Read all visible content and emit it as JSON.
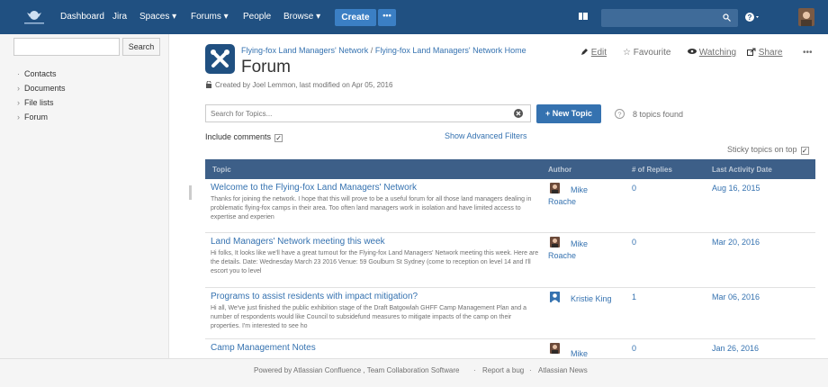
{
  "topnav": {
    "menu": [
      "Dashboard",
      "Jira",
      "Spaces ▾",
      "Forums ▾",
      "People",
      "Browse ▾"
    ],
    "create_label": "Create",
    "more_label": "•••"
  },
  "sidebar": {
    "search_button": "Search",
    "items": [
      {
        "label": "Contacts",
        "chevron": "·"
      },
      {
        "label": "Documents",
        "chevron": "›"
      },
      {
        "label": "File lists",
        "chevron": "›"
      },
      {
        "label": "Forum",
        "chevron": "›"
      }
    ]
  },
  "breadcrumb": {
    "parts": [
      "Flying-fox Land Managers' Network",
      "/",
      "Flying-fox Land Managers' Network Home"
    ]
  },
  "page": {
    "title": "Forum",
    "meta": "Created by Joel Lemmon, last modified on Apr 05, 2016"
  },
  "actions": {
    "edit": "Edit",
    "favourite": "Favourite",
    "watching": "Watching",
    "share": "Share",
    "more": "•••"
  },
  "search": {
    "placeholder": "Search for Topics...",
    "new_topic": "+ New Topic",
    "found": "8 topics found",
    "include_comments": "Include comments",
    "advanced": "Show Advanced Filters",
    "sticky": "Sticky topics on top",
    "checkmark": "✓"
  },
  "table": {
    "headers": [
      "Topic",
      "Author",
      "# of Replies",
      "Last Activity Date"
    ],
    "rows": [
      {
        "title": "Welcome to the Flying-fox Land Managers' Network",
        "excerpt": "Thanks for joining the network. I hope that this will prove to be a useful forum for all those land managers dealing in problematic flying-fox camps in their area. Too often land managers work in isolation and have limited access to expertise and experien",
        "author_first": "Mike",
        "author_last": "Roache",
        "replies": "0",
        "date": "Aug 16, 2015"
      },
      {
        "title": "Land Managers' Network meeting this week",
        "excerpt": "Hi folks, It looks like we'll have a great turnout for the Flying-fox Land Managers' Network meeting this week. Here are the details.  Date: Wednesday March 23 2016 Venue: 59 Goulburn St Sydney (come to reception on level 14 and I'll escort you to level",
        "author_first": "Mike",
        "author_last": "Roache",
        "replies": "0",
        "date": "Mar 20, 2016"
      },
      {
        "title": "Programs to assist residents with impact mitigation?",
        "excerpt": "Hi all, We've just finished the public exhibition stage of the Draft Batgowlah GHFF Camp Management Plan and a number of respondents would like Council to subsidefund measures to mitigate impacts of the camp on their properties.  I'm interested to see ho",
        "author_first": "Kristie King",
        "author_last": "",
        "replies": "1",
        "date": "Mar 06, 2016"
      },
      {
        "title": "Camp Management Notes",
        "excerpt": "",
        "author_first": "Mike",
        "author_last": "",
        "replies": "0",
        "date": "Jan 26, 2016"
      }
    ]
  },
  "footer": {
    "powered": "Powered by Atlassian Confluence , Team Collaboration Software",
    "sep": "·",
    "report": "Report a bug",
    "news": "Atlassian News"
  }
}
